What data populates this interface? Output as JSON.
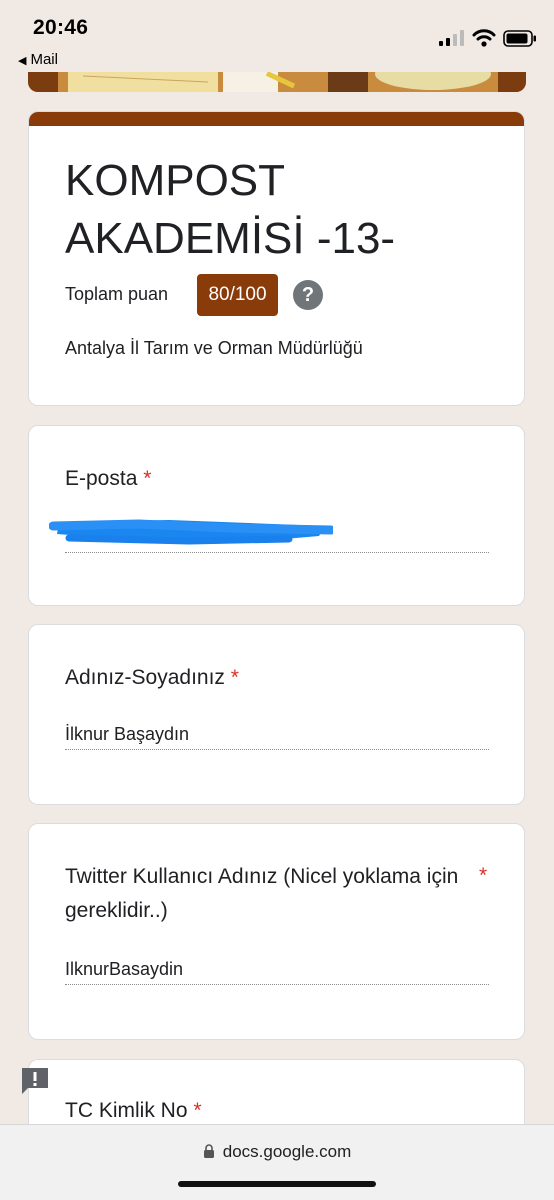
{
  "status_bar": {
    "time": "20:46",
    "back_label": "Mail"
  },
  "form": {
    "title": "KOMPOST AKADEMİSİ -13-",
    "score_label": "Toplam puan",
    "score": "80/100",
    "help_icon": "?",
    "description": "Antalya İl Tarım ve Orman Müdürlüğü",
    "theme_color": "#8a3b0a"
  },
  "questions": [
    {
      "label": "E-posta",
      "required": "*",
      "value": ""
    },
    {
      "label": "Adınız-Soyadınız",
      "required": "*",
      "value": "İlknur Başaydın"
    },
    {
      "label": "Twitter Kullanıcı Adınız (Nicel yoklama için gereklidir..)",
      "required": "*",
      "value": "IlknurBasaydin"
    },
    {
      "label": "TC Kimlik No",
      "required": "*"
    }
  ],
  "browser": {
    "url": "docs.google.com"
  },
  "icons": {
    "back": "triangle-left-icon",
    "signal": "cellular-signal-icon",
    "wifi": "wifi-icon",
    "battery": "battery-icon",
    "help": "question-mark-icon",
    "report": "report-feedback-icon",
    "lock": "lock-icon"
  }
}
